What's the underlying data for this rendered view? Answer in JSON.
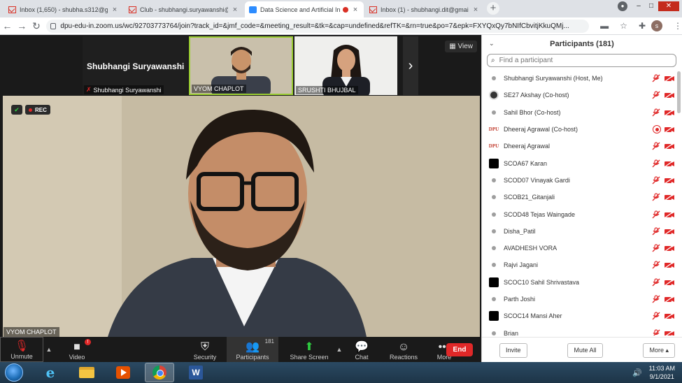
{
  "browser": {
    "tabs": [
      {
        "title": "Inbox (1,650) - shubha.s312@gm",
        "icon": "gmail-icon",
        "active": false
      },
      {
        "title": "Club - shubhangi.suryawanshi@",
        "icon": "gmail-icon",
        "active": false
      },
      {
        "title": "Data Science and Artificial In",
        "icon": "zoom-icon",
        "active": true,
        "recording": true
      },
      {
        "title": "Inbox (1) - shubhangi.dit@gmail",
        "icon": "gmail-icon",
        "active": false
      }
    ],
    "close_glyph": "×",
    "new_tab_glyph": "+",
    "url": "dpu-edu-in.zoom.us/wc/92703773764/join?track_id=&jmf_code=&meeting_result=&tk=&cap=undefined&refTK=&rn=true&po=7&epk=FXYQxQy7bNIfCbvitjKkuQMj...",
    "profile_initial": "s"
  },
  "meeting": {
    "self_name_big": "Shubhangi Suryawanshi",
    "self_label": "Shubhangi Suryawanshi",
    "thumb2_label": "VYOM CHAPLOT",
    "thumb3_label": "SRUSHTI BHUJBAL",
    "view_label": "View",
    "rec_label": "REC",
    "speaker_name": "VYOM CHAPLOT"
  },
  "toolbar": {
    "unmute": "Unmute",
    "video": "Video",
    "video_badge": "!",
    "security": "Security",
    "participants": "Participants",
    "participants_count": "181",
    "share": "Share Screen",
    "chat": "Chat",
    "reactions": "Reactions",
    "more": "More",
    "end": "End"
  },
  "panel": {
    "title": "Participants (181)",
    "search_placeholder": "Find a participant",
    "participants": [
      {
        "name": "Shubhangi Suryawanshi (Host, Me)",
        "avatar": "generic",
        "recording": false
      },
      {
        "name": "SE27 Akshay (Co-host)",
        "avatar": "photo",
        "recording": false
      },
      {
        "name": "Sahil Bhor (Co-host)",
        "avatar": "generic",
        "recording": false
      },
      {
        "name": "Dheeraj Agrawal (Co-host)",
        "avatar": "dpu",
        "recording": true
      },
      {
        "name": "Dheeraj Agrawal",
        "avatar": "dpu",
        "recording": false
      },
      {
        "name": "SCOA67 Karan",
        "avatar": "black",
        "recording": false
      },
      {
        "name": "SCOD07 Vinayak Gardi",
        "avatar": "generic",
        "recording": false
      },
      {
        "name": "SCOB21_Gitanjali",
        "avatar": "generic",
        "recording": false
      },
      {
        "name": "SCOD48 Tejas Waingade",
        "avatar": "generic",
        "recording": false
      },
      {
        "name": "Disha_Patil",
        "avatar": "generic",
        "recording": false
      },
      {
        "name": "AVADHESH VORA",
        "avatar": "generic",
        "recording": false
      },
      {
        "name": "Rajvi Jagani",
        "avatar": "generic",
        "recording": false
      },
      {
        "name": "SCOC10 Sahil Shrivastava",
        "avatar": "black",
        "recording": false
      },
      {
        "name": "Parth Joshi",
        "avatar": "generic",
        "recording": false
      },
      {
        "name": "SCOC14 Mansi Aher",
        "avatar": "black",
        "recording": false
      },
      {
        "name": "Brian",
        "avatar": "generic",
        "recording": false
      }
    ],
    "dpu_text": "DPU",
    "invite": "Invite",
    "mute_all": "Mute All",
    "more": "More ▴"
  },
  "taskbar": {
    "time": "11:03 AM",
    "date": "9/1/2021",
    "word_letter": "W",
    "ie_letter": "e"
  }
}
